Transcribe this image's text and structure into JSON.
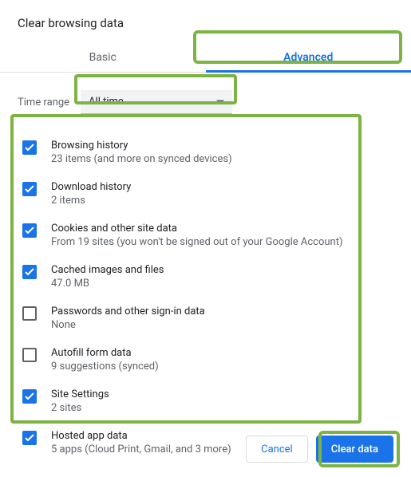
{
  "dialog": {
    "title": "Clear browsing data"
  },
  "tabs": {
    "basic": "Basic",
    "advanced": "Advanced"
  },
  "time": {
    "label": "Time range",
    "value": "All time"
  },
  "items": [
    {
      "checked": true,
      "title": "Browsing history",
      "sub": "23 items (and more on synced devices)"
    },
    {
      "checked": true,
      "title": "Download history",
      "sub": "2 items"
    },
    {
      "checked": true,
      "title": "Cookies and other site data",
      "sub": "From 19 sites (you won't be signed out of your Google Account)"
    },
    {
      "checked": true,
      "title": "Cached images and files",
      "sub": "47.0 MB"
    },
    {
      "checked": false,
      "title": "Passwords and other sign-in data",
      "sub": "None"
    },
    {
      "checked": false,
      "title": "Autofill form data",
      "sub": "9 suggestions (synced)"
    },
    {
      "checked": true,
      "title": "Site Settings",
      "sub": "2 sites"
    },
    {
      "checked": true,
      "title": "Hosted app data",
      "sub": "5 apps (Cloud Print, Gmail, and 3 more)"
    }
  ],
  "footer": {
    "cancel": "Cancel",
    "clear": "Clear data"
  }
}
